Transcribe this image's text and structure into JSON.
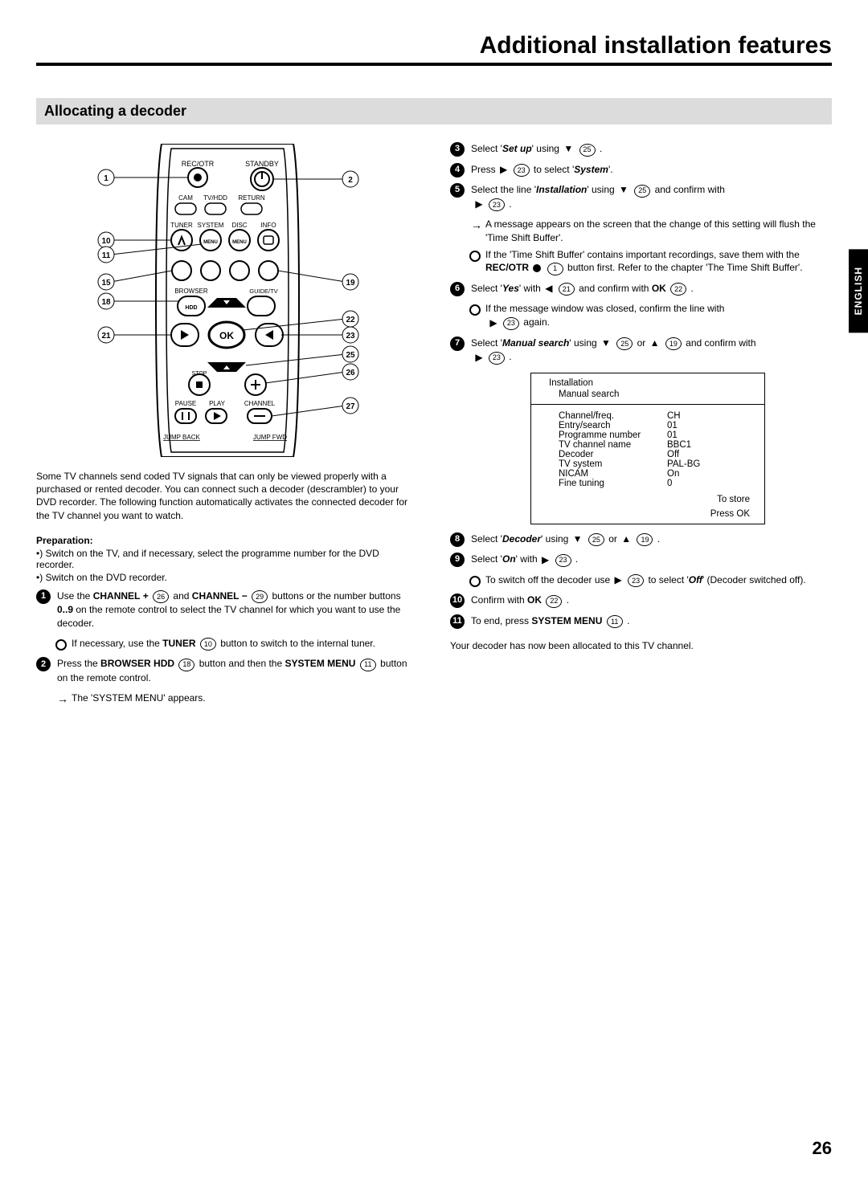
{
  "page": {
    "chapter_title": "Additional installation features",
    "page_number": "26",
    "language_tab": "ENGLISH"
  },
  "section": {
    "title": "Allocating a decoder"
  },
  "remote_labels": {
    "rec_otr": "REC/OTR",
    "standby": "STANDBY",
    "cam": "CAM",
    "tvhdd": "TV/HDD",
    "return": "RETURN",
    "tuner": "TUNER",
    "system": "SYSTEM",
    "disc": "DISC",
    "info": "INFO",
    "menu": "MENU",
    "browser": "BROWSER",
    "guide": "GUIDE/TV",
    "hdd": "HDD",
    "ok": "OK",
    "stop": "STOP",
    "pause": "PAUSE",
    "play": "PLAY",
    "channel": "CHANNEL",
    "jump_back": "JUMP BACK",
    "jump_fwd": "JUMP FWD"
  },
  "remote_callouts": {
    "c1": "1",
    "c2": "2",
    "c10": "10",
    "c11": "11",
    "c15": "15",
    "c18": "18",
    "c19": "19",
    "c21": "21",
    "c22": "22",
    "c23": "23",
    "c25": "25",
    "c26": "26",
    "c27": "27"
  },
  "intro": "Some TV channels send coded TV signals that can only be viewed properly with a purchased or rented decoder. You can connect such a decoder (descrambler) to your DVD recorder. The following function automatically activates the connected decoder for the TV channel you want to watch.",
  "prep": {
    "head": "Preparation:",
    "b1": "•) Switch on the TV, and if necessary, select the programme number for the DVD recorder.",
    "b2": "•) Switch on the DVD recorder."
  },
  "steps_left": {
    "s1_pre": "Use the ",
    "s1_chp": "CHANNEL",
    "s1_plus": "+",
    "k26": "26",
    "s1_and": " and ",
    "s1_chm": "CHANNEL",
    "s1_minus": "−",
    "k29": "29",
    "s1_post": " buttons or the number buttons ",
    "s1_nums": "0..9",
    "s1_post2": " on the remote control to select the TV channel for which you want to use the decoder.",
    "s1_sub_pre": "If necessary, use the ",
    "s1_sub_btn": "TUNER",
    "k10": "10",
    "s1_sub_post": " button to switch to the internal tuner.",
    "s2_pre": "Press the ",
    "s2_btn1": "BROWSER HDD",
    "k18": "18",
    "s2_mid": " button and then the ",
    "s2_btn2": "SYSTEM MENU",
    "k11": "11",
    "s2_post": " button on the remote control.",
    "s2_sub": "The 'SYSTEM MENU' appears."
  },
  "steps_right": {
    "s3_pre": "Select '",
    "s3_item": "Set up",
    "s3_post": "' using ",
    "k25": "25",
    "s3_end": " .",
    "s4_pre": "Press ",
    "k23": "23",
    "s4_mid": " to select '",
    "s4_item": "System",
    "s4_post": "'.",
    "s5_pre": "Select the line '",
    "s5_item": "Installation",
    "s5_post": "' using ",
    "s5_conf": " and confirm with",
    "s5_sub1": "A message appears on the screen that the change of this setting will flush the 'Time Shift Buffer'.",
    "s5_sub2_pre": "If the 'Time Shift Buffer' contains important recordings, save them with the ",
    "s5_sub2_btn": "REC/OTR",
    "k1": "1",
    "s5_sub2_post": " button first. Refer to the chapter 'The Time Shift Buffer'.",
    "s6_pre": "Select '",
    "s6_item": "Yes",
    "s6_mid": "' with ",
    "k21": "21",
    "s6_conf": " and confirm with ",
    "ok": "OK",
    "k22": "22",
    "s6_end": " .",
    "s6_sub_pre": "If the message window was closed, confirm the line with",
    "s6_sub_post": " again.",
    "s7_pre": "Select '",
    "s7_item": "Manual search",
    "s7_post": "' using ",
    "k19": "19",
    "s7_conf": " and confirm with",
    "s8_pre": "Select '",
    "s8_item": "Decoder",
    "s8_post": "' using ",
    "s9_pre": "Select '",
    "s9_item": "On",
    "s9_post": "' with ",
    "s9_end": " .",
    "s9_sub_pre": "To switch off the decoder use ",
    "s9_sub_mid": " to select '",
    "s9_sub_off": "Off",
    "s9_sub_post": "' (Decoder switched off).",
    "s10_pre": "Confirm with ",
    "s10_end": " .",
    "s11_pre": "To end, press ",
    "s11_btn": "SYSTEM MENU",
    "s11_end": " .",
    "closing": "Your decoder has now been allocated to this TV channel."
  },
  "osd": {
    "title": "Installation",
    "subtitle": "Manual search",
    "rows": [
      {
        "k": "Channel/freq.",
        "v": "CH"
      },
      {
        "k": "Entry/search",
        "v": "01"
      },
      {
        "k": "Programme number",
        "v": "01"
      },
      {
        "k": "TV channel name",
        "v": "BBC1"
      },
      {
        "k": "Decoder",
        "v": "Off"
      },
      {
        "k": "TV system",
        "v": "PAL-BG"
      },
      {
        "k": "NICAM",
        "v": "On"
      },
      {
        "k": "Fine tuning",
        "v": "0"
      }
    ],
    "foot1": "To store",
    "foot2": "Press OK"
  }
}
